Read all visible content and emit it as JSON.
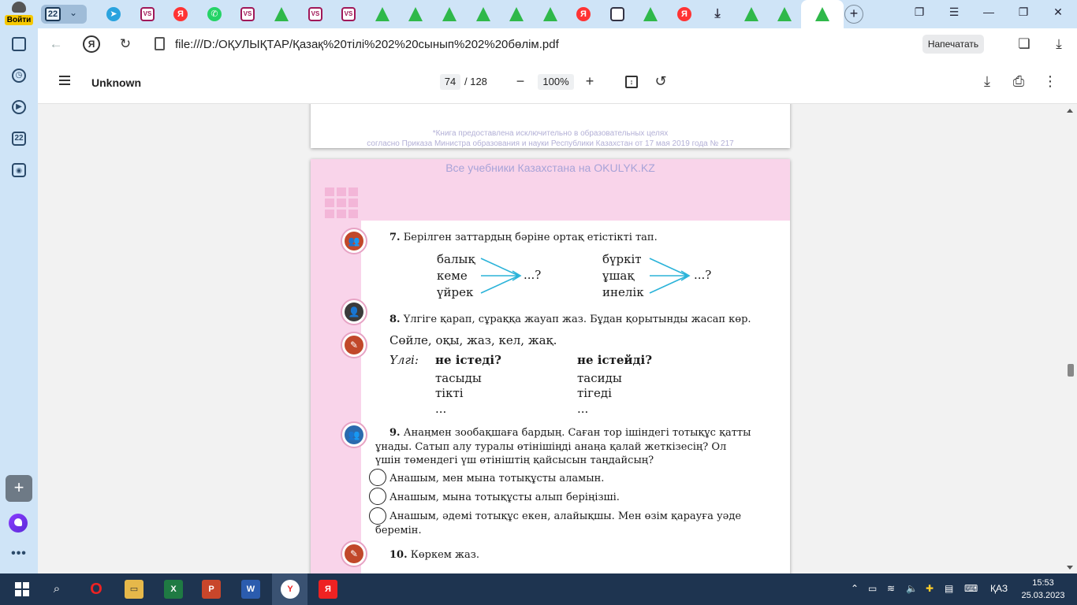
{
  "sidebar": {
    "account_label": "Войти",
    "tab_count": "22"
  },
  "tabs": {
    "count": "22"
  },
  "address_bar": {
    "url": "file:///D:/ОҚУЛЫҚТАР/Қазақ%20тілі%202%20сынып%202%20бөлім.pdf",
    "print_label": "Напечатать"
  },
  "pdf_toolbar": {
    "title": "Unknown",
    "page_current": "74",
    "page_total": "/ 128",
    "zoom": "100%"
  },
  "prev_page": {
    "disclaimer_line1": "*Книга предоставлена исключительно в образовательных целях",
    "disclaimer_line2": "согласно Приказа Министра образования и науки Республики Казахстан от 17 мая 2019 года № 217"
  },
  "page": {
    "watermark": "Все учебники Казахстана на OKULYK.KZ",
    "task7": {
      "num": "7.",
      "text": "Берілген заттардың бәріне ортақ етістікті тап.",
      "left_words": [
        "балық",
        "кеме",
        "үйрек"
      ],
      "right_words": [
        "бүркіт",
        "ұшақ",
        "инелік"
      ],
      "question": "...?"
    },
    "task8": {
      "num": "8.",
      "text": "Үлгіге қарап, сұраққа жауап жаз. Бұдан қорытынды жасап көр.",
      "words": "Сөйле, оқы, жаз, кел, жақ.",
      "sample_label": "Үлгі:",
      "col1_head": "не істеді?",
      "col2_head": "не істейді?",
      "col1": [
        "тасыды",
        "тікті",
        "..."
      ],
      "col2": [
        "тасиды",
        "тігеді",
        "..."
      ]
    },
    "task9": {
      "num": "9.",
      "line1": "Анаңмен зообақшаға бардың. Саған тор ішіндегі тотықұс қатты",
      "line2": "ұнады. Сатып алу туралы өтінішіңді анаңа қалай жеткізесің? Ол",
      "line3": "үшін төмендегі үш өтініштің қайсысын таңдайсың?",
      "options": [
        "Анашым, мен мына тотықұсты аламын.",
        "Анашым, мына тотықұсты алып беріңізші.",
        "Анашым, әдемі тотықұс екен, алайықшы. Мен өзім қарауға уәде"
      ],
      "option3_cont": "беремін."
    },
    "task10": {
      "num": "10.",
      "text": "Көркем жаз."
    }
  },
  "taskbar": {
    "lang": "ҚАЗ",
    "time": "15:53",
    "date": "25.03.2023"
  },
  "colors": {
    "accent_pink": "#f9d4ea",
    "arrow_cyan": "#2bb3d9",
    "taskbar": "#1e3450",
    "sidebar": "#cfe4f7"
  }
}
